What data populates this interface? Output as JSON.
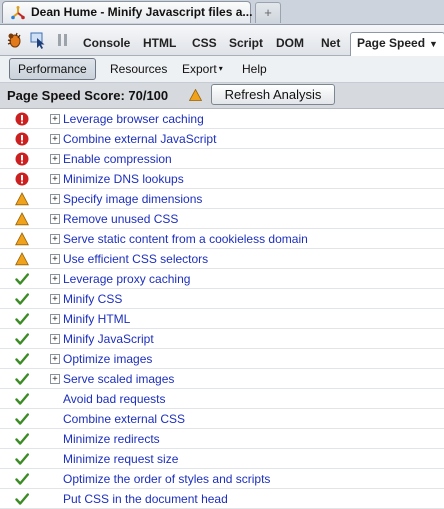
{
  "browser": {
    "tab_title": "Dean Hume - Minify Javascript files a...",
    "new_tab_label": "+"
  },
  "firebug": {
    "tabs": [
      "Console",
      "HTML",
      "CSS",
      "Script",
      "DOM",
      "Net"
    ],
    "selected_tab": "Page Speed",
    "selected_tab_chevron": "▼"
  },
  "menu": {
    "performance": "Performance",
    "resources": "Resources",
    "export": "Export",
    "export_chevron": "▾",
    "help": "Help"
  },
  "score": {
    "text": "Page Speed Score: 70/100",
    "refresh_label": "Refresh Analysis"
  },
  "colors": {
    "error": "#cc1f1f",
    "warning": "#f0a21a",
    "pass": "#3c8c26",
    "link": "#1d2fbd"
  },
  "rules": [
    {
      "label": "Leverage browser caching",
      "status": "error",
      "expandable": true
    },
    {
      "label": "Combine external JavaScript",
      "status": "error",
      "expandable": true
    },
    {
      "label": "Enable compression",
      "status": "error",
      "expandable": true
    },
    {
      "label": "Minimize DNS lookups",
      "status": "error",
      "expandable": true
    },
    {
      "label": "Specify image dimensions",
      "status": "warning",
      "expandable": true
    },
    {
      "label": "Remove unused CSS",
      "status": "warning",
      "expandable": true
    },
    {
      "label": "Serve static content from a cookieless domain",
      "status": "warning",
      "expandable": true
    },
    {
      "label": "Use efficient CSS selectors",
      "status": "warning",
      "expandable": true
    },
    {
      "label": "Leverage proxy caching",
      "status": "pass",
      "expandable": true
    },
    {
      "label": "Minify CSS",
      "status": "pass",
      "expandable": true
    },
    {
      "label": "Minify HTML",
      "status": "pass",
      "expandable": true
    },
    {
      "label": "Minify JavaScript",
      "status": "pass",
      "expandable": true
    },
    {
      "label": "Optimize images",
      "status": "pass",
      "expandable": true
    },
    {
      "label": "Serve scaled images",
      "status": "pass",
      "expandable": true
    },
    {
      "label": "Avoid bad requests",
      "status": "pass",
      "expandable": false
    },
    {
      "label": "Combine external CSS",
      "status": "pass",
      "expandable": false
    },
    {
      "label": "Minimize redirects",
      "status": "pass",
      "expandable": false
    },
    {
      "label": "Minimize request size",
      "status": "pass",
      "expandable": false
    },
    {
      "label": "Optimize the order of styles and scripts",
      "status": "pass",
      "expandable": false
    },
    {
      "label": "Put CSS in the document head",
      "status": "pass",
      "expandable": false
    }
  ]
}
